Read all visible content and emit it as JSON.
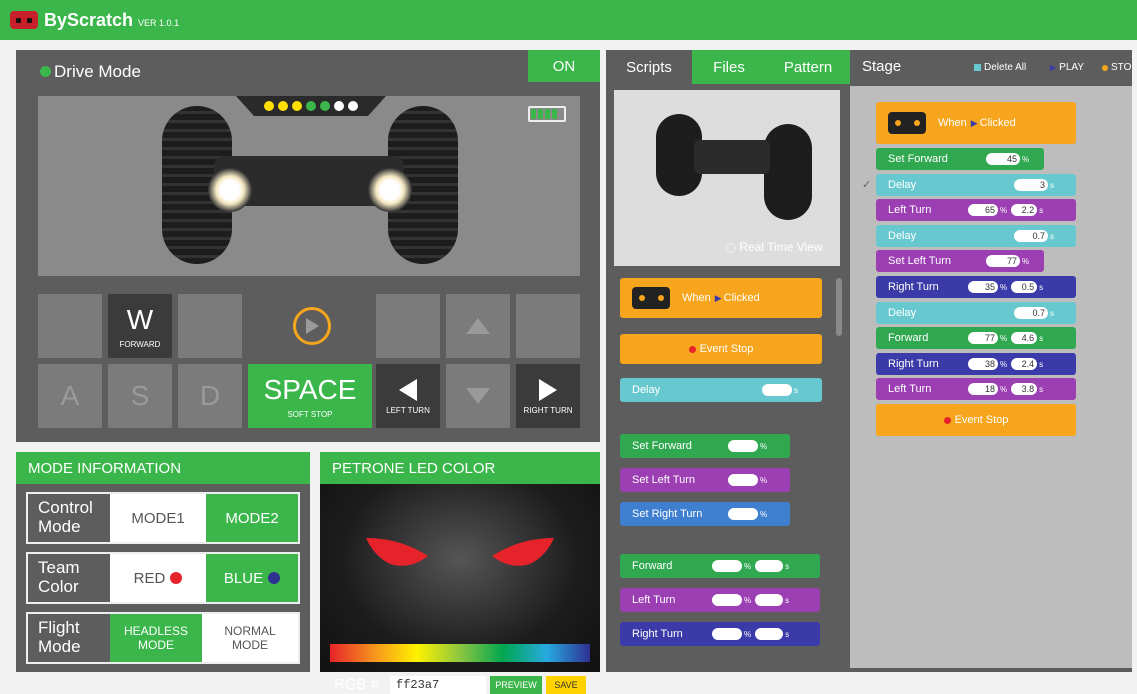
{
  "app": {
    "title": "ByScratch",
    "version": "VER 1.0.1"
  },
  "drive": {
    "title": "Drive Mode",
    "on_label": "ON"
  },
  "keypad": {
    "w": "W",
    "w_caption": "FORWARD",
    "a": "A",
    "s": "S",
    "d": "D",
    "space": "SPACE",
    "space_caption": "SOFT STOP",
    "left_caption": "LEFT TURN",
    "right_caption": "RIGHT TURN"
  },
  "mode_info": {
    "title": "MODE INFORMATION",
    "rows": [
      {
        "label": "Control Mode",
        "opt1": "MODE1",
        "opt2": "MODE2"
      },
      {
        "label": "Team Color",
        "opt1": "RED",
        "opt2": "BLUE"
      },
      {
        "label": "Flight Mode",
        "opt1": "HEADLESS MODE",
        "opt2": "NORMAL MODE"
      }
    ]
  },
  "led": {
    "title": "PETRONE LED COLOR",
    "rgb_label": "RGB #",
    "rgb_value": "ff23a7",
    "preview": "PREVIEW",
    "save": "SAVE"
  },
  "tabs": {
    "scripts": "Scripts",
    "files": "Files",
    "pattern": "Pattern",
    "stage": "Stage"
  },
  "stage_controls": {
    "delete_all": "Delete All",
    "play": "PLAY",
    "stop": "STO"
  },
  "preview": {
    "realtime": "Real Time View"
  },
  "palette": {
    "when": "When",
    "clicked": "Clicked",
    "event_stop": "Event Stop",
    "delay": "Delay",
    "set_forward": "Set Forward",
    "set_left_turn": "Set Left Turn",
    "set_right_turn": "Set Right Turn",
    "forward": "Forward",
    "left_turn": "Left Turn",
    "right_turn": "Right Turn",
    "pct": "%",
    "sec": "s"
  },
  "stage_script": {
    "set_forward": "45",
    "delay1": "3",
    "left_turn": [
      "65",
      "2.2"
    ],
    "delay2": "0.7",
    "set_left_turn": "77",
    "right_turn": [
      "35",
      "0.5"
    ],
    "delay3": "0.7",
    "forward": [
      "77",
      "4.6"
    ],
    "right_turn2": [
      "38",
      "2.4"
    ],
    "left_turn2": [
      "18",
      "3.8"
    ]
  },
  "colors": {
    "accent": "#3bb64a",
    "panel": "#5d5d5d",
    "block_orange": "#f7a51c",
    "led_red": "#e6232a"
  }
}
